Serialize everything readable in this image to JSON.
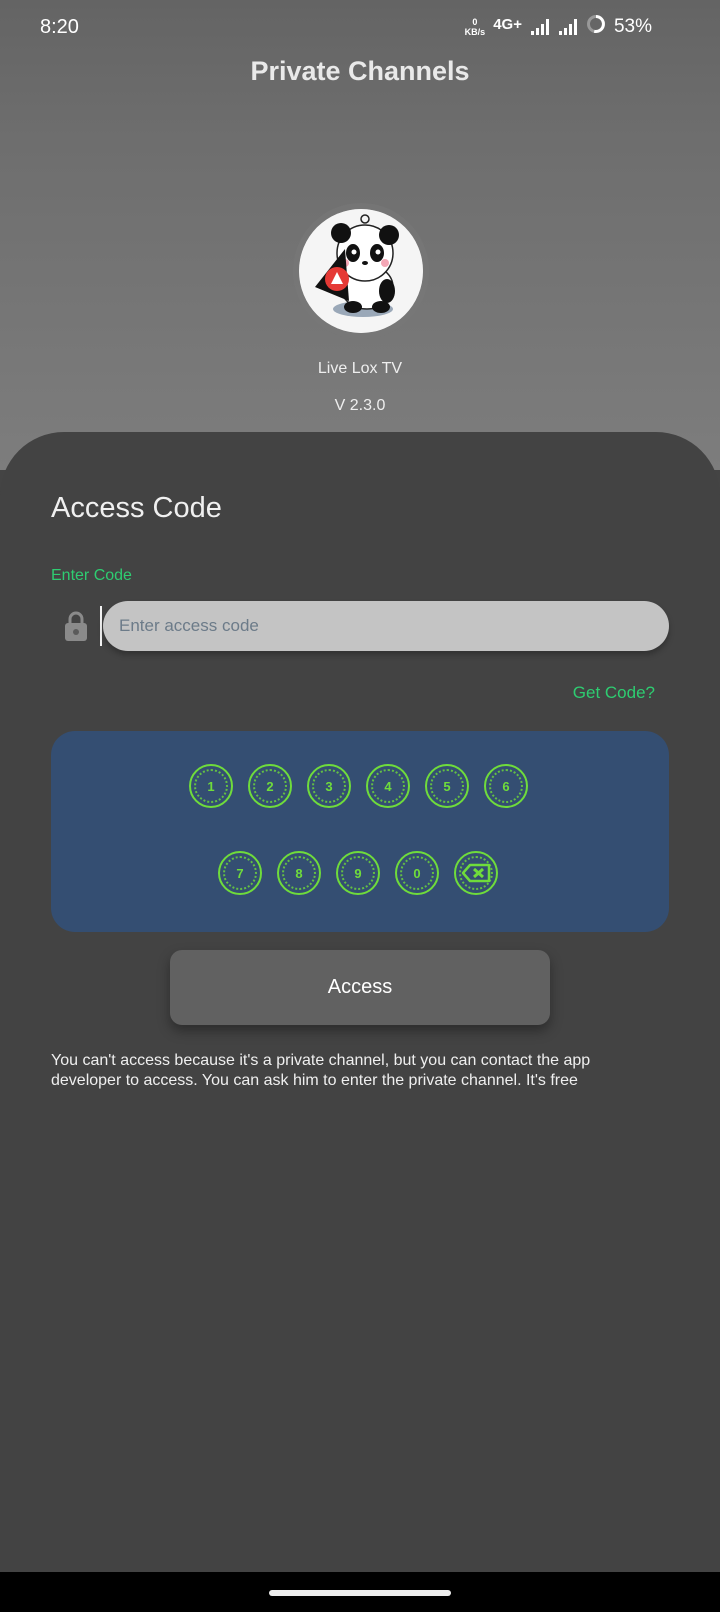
{
  "status_bar": {
    "time": "8:20",
    "net_speed_value": "0",
    "net_speed_unit": "KB/s",
    "network": "4G+",
    "battery": "53%"
  },
  "header": {
    "title": "Private Channels"
  },
  "app": {
    "name": "Live Lox TV",
    "version": "V 2.3.0"
  },
  "access": {
    "title": "Access Code",
    "label": "Enter Code",
    "placeholder": "Enter access code",
    "value": "",
    "get_code": "Get Code?",
    "button": "Access",
    "info": "You can't access because it's a private channel, but you can contact the app developer to access. You can ask him to enter the private channel. It's free"
  },
  "keypad": {
    "row1": [
      "1",
      "2",
      "3",
      "4",
      "5",
      "6"
    ],
    "row2": [
      "7",
      "8",
      "9",
      "0"
    ],
    "delete_icon": "backspace-icon"
  },
  "colors": {
    "accent_green": "#2ecc71",
    "keypad_bg": "#344e72",
    "key_green": "#6fdc3b",
    "sheet_bg": "#434343"
  }
}
